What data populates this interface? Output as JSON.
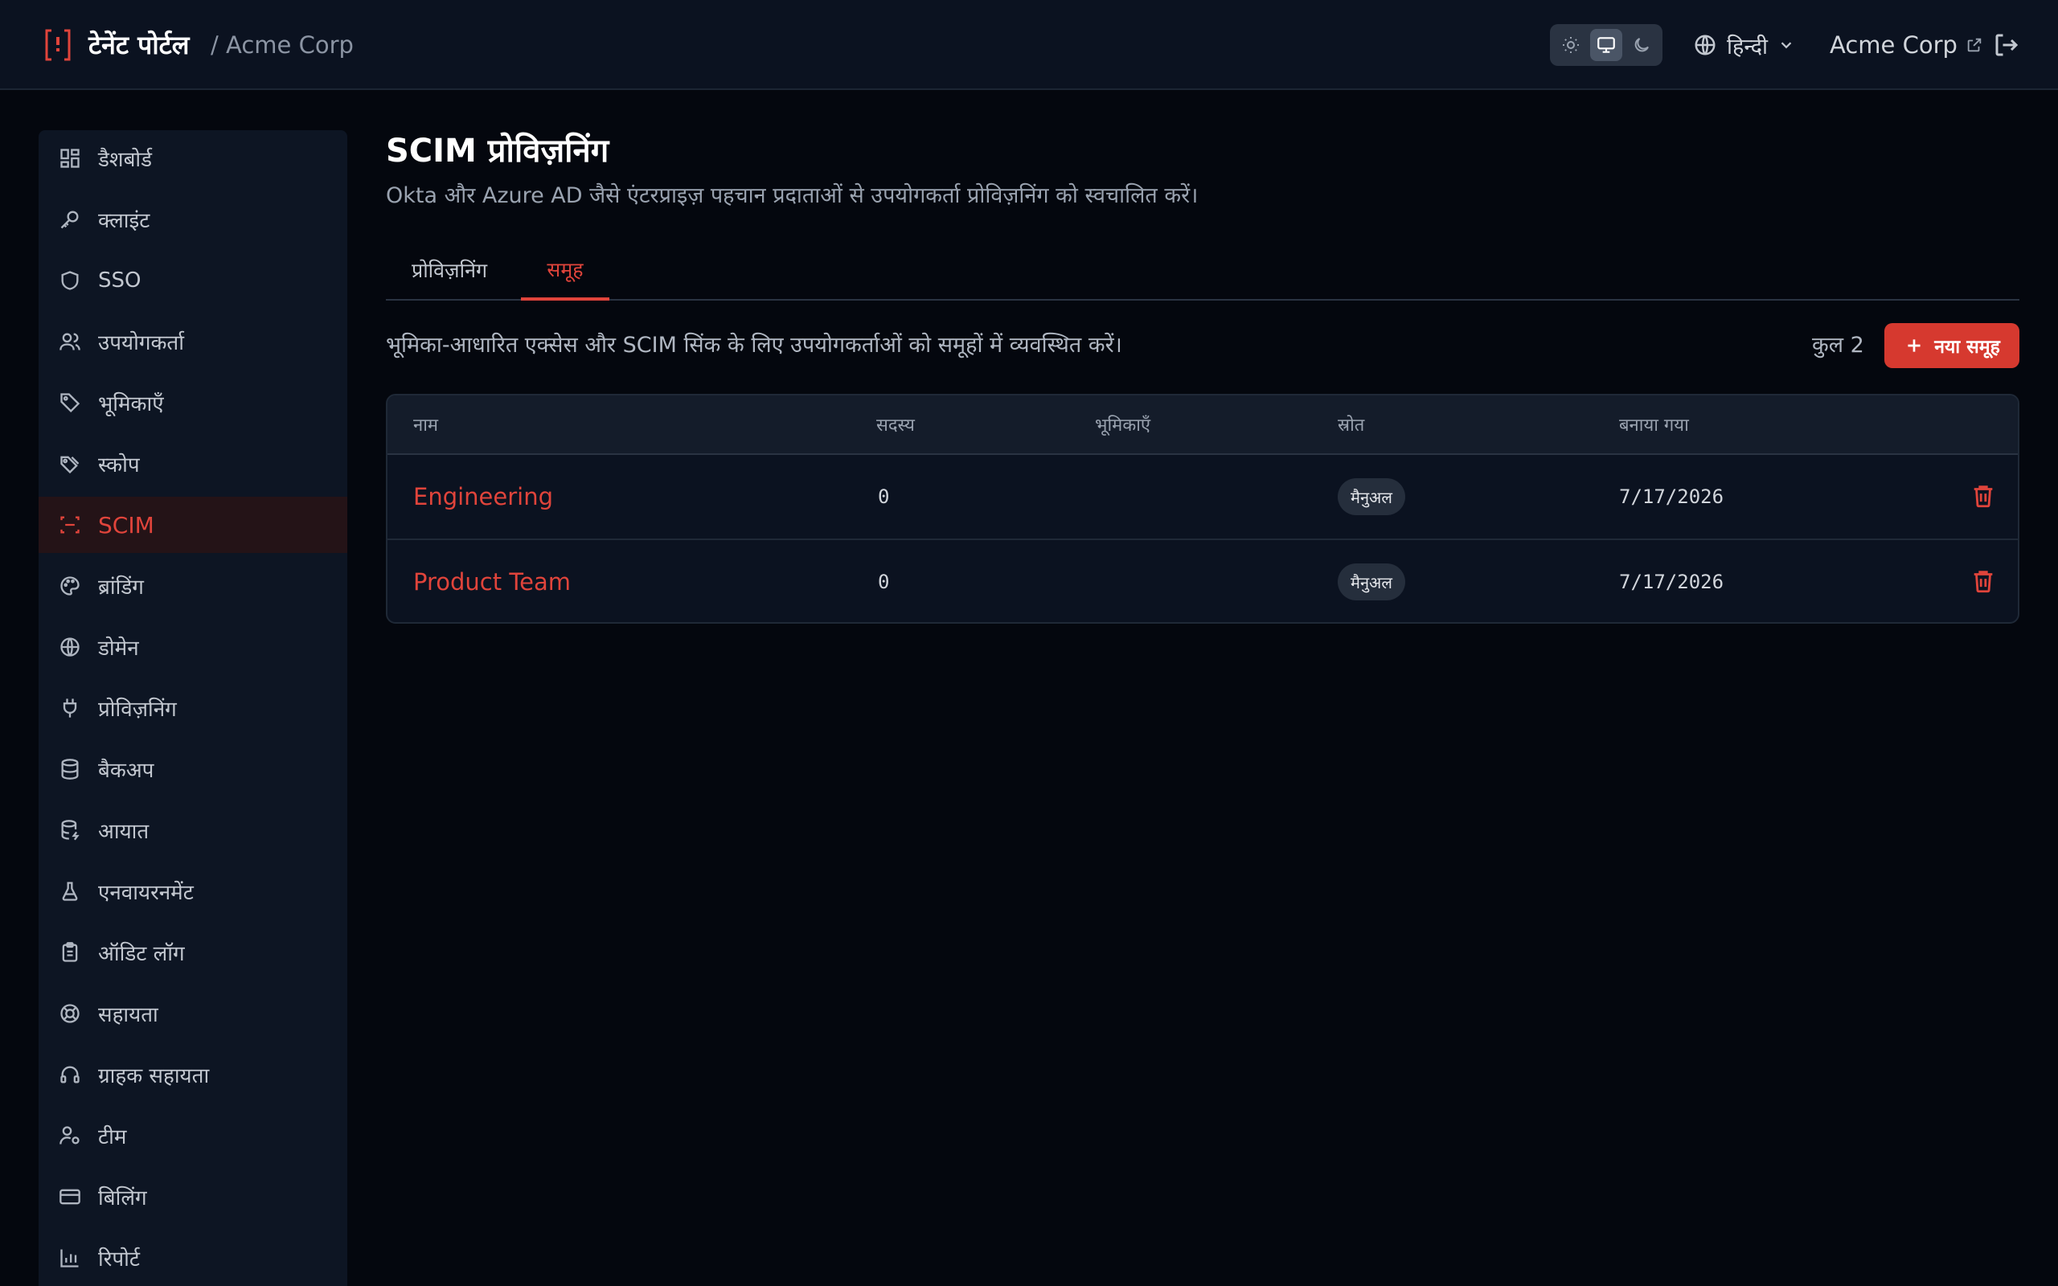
{
  "header": {
    "title": "टेनेंट पोर्टल",
    "tenant": "/ Acme Corp",
    "language": "हिन्दी",
    "account": "Acme Corp"
  },
  "colors": {
    "accent": "#e0443b",
    "background": "#04070e",
    "surface": "#0d1523"
  },
  "sidebar": {
    "items": [
      {
        "label": "डैशबोर्ड",
        "icon": "dashboard-icon"
      },
      {
        "label": "क्लाइंट",
        "icon": "key-icon"
      },
      {
        "label": "SSO",
        "icon": "shield-icon"
      },
      {
        "label": "उपयोगकर्ता",
        "icon": "users-icon"
      },
      {
        "label": "भूमिकाएँ",
        "icon": "tag-icon"
      },
      {
        "label": "स्कोप",
        "icon": "tags-icon"
      },
      {
        "label": "SCIM",
        "icon": "scan-icon",
        "active": true
      },
      {
        "label": "ब्रांडिंग",
        "icon": "palette-icon"
      },
      {
        "label": "डोमेन",
        "icon": "globe-icon"
      },
      {
        "label": "प्रोविज़निंग",
        "icon": "plug-icon"
      },
      {
        "label": "बैकअप",
        "icon": "database-icon"
      },
      {
        "label": "आयात",
        "icon": "database-import-icon"
      },
      {
        "label": "एनवायरनमेंट",
        "icon": "flask-icon"
      },
      {
        "label": "ऑडिट लॉग",
        "icon": "clipboard-icon"
      },
      {
        "label": "सहायता",
        "icon": "lifebuoy-icon"
      },
      {
        "label": "ग्राहक सहायता",
        "icon": "headset-icon"
      },
      {
        "label": "टीम",
        "icon": "user-cog-icon"
      },
      {
        "label": "बिलिंग",
        "icon": "credit-card-icon"
      },
      {
        "label": "रिपोर्ट",
        "icon": "bar-chart-icon"
      }
    ]
  },
  "main": {
    "title": "SCIM प्रोविज़निंग",
    "description": "Okta और Azure AD जैसे एंटरप्राइज़ पहचान प्रदाताओं से उपयोगकर्ता प्रोविज़निंग को स्वचालित करें।",
    "tabs": [
      {
        "label": "प्रोविज़निंग"
      },
      {
        "label": "समूह",
        "active": true
      }
    ],
    "section_description": "भूमिका-आधारित एक्सेस और SCIM सिंक के लिए उपयोगकर्ताओं को समूहों में व्यवस्थित करें।",
    "count": "कुल 2",
    "new_button": "नया समूह"
  },
  "table": {
    "columns": [
      "नाम",
      "सदस्य",
      "भूमिकाएँ",
      "स्रोत",
      "बनाया गया"
    ],
    "rows": [
      {
        "name": "Engineering",
        "members": "0",
        "roles": "",
        "source": "मैनुअल",
        "created": "7/17/2026"
      },
      {
        "name": "Product Team",
        "members": "0",
        "roles": "",
        "source": "मैनुअल",
        "created": "7/17/2026"
      }
    ]
  }
}
